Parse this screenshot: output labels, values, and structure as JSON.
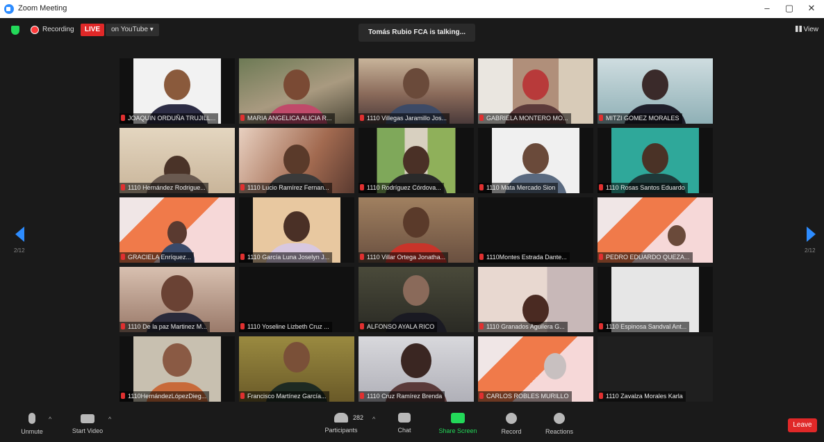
{
  "window": {
    "title": "Zoom Meeting",
    "minimize": "–",
    "maximize": "▢",
    "close": "✕"
  },
  "topbar": {
    "recording_label": "Recording",
    "live_label": "LIVE",
    "youtube_label": "on YouTube ▾",
    "talking": "Tomás Rubio FCA is talking...",
    "view_label": "View"
  },
  "gallery": {
    "tiles": [
      {
        "name": "JOAQUIN ORDUÑA TRUJILL..."
      },
      {
        "name": "MARIA ANGELICA ALICIA R..."
      },
      {
        "name": "1110 Villegas Jaramillo Jos..."
      },
      {
        "name": "GABRIELA MONTERO MO..."
      },
      {
        "name": "MITZI GOMEZ MORALES"
      },
      {
        "name": "1110 Hernández Rodrigue..."
      },
      {
        "name": "1110 Lucio Ramírez Fernan..."
      },
      {
        "name": "1110 Rodríguez Córdova..."
      },
      {
        "name": "1110 Mata Mercado Sion"
      },
      {
        "name": "1110 Rosas Santos Eduardo"
      },
      {
        "name": "GRACIELA Enríquez..."
      },
      {
        "name": "1110 García Luna Joselyn J..."
      },
      {
        "name": "1110 Villar Ortega Jonatha..."
      },
      {
        "name": "1110Montes Estrada Dante..."
      },
      {
        "name": "PEDRO EDUARDO QUEZA..."
      },
      {
        "name": "1110 De la paz Martinez M..."
      },
      {
        "name": "1110 Yoseline Lizbeth Cruz ..."
      },
      {
        "name": "ALFONSO AYALA RICO"
      },
      {
        "name": "1110 Granados Aguilera G..."
      },
      {
        "name": "1110 Espinosa Sandval Ant..."
      },
      {
        "name": "1110HernándezLópezDieg..."
      },
      {
        "name": "Francisco Martínez García..."
      },
      {
        "name": "1110 Cruz Ramírez Brenda"
      },
      {
        "name": "CARLOS ROBLES MURILLO"
      },
      {
        "name": "1110 Zavalza Morales Karla"
      }
    ],
    "page_left": "2/12",
    "page_right": "2/12"
  },
  "toolbar": {
    "unmute": "Unmute",
    "start_video": "Start Video",
    "participants": "Participants",
    "participants_count": "282",
    "chat": "Chat",
    "share_screen": "Share Screen",
    "record": "Record",
    "reactions": "Reactions",
    "leave": "Leave"
  },
  "colors": {
    "accent": "#2d8cff",
    "live": "#e02828",
    "share": "#23d959",
    "background": "#1a1a1a"
  }
}
